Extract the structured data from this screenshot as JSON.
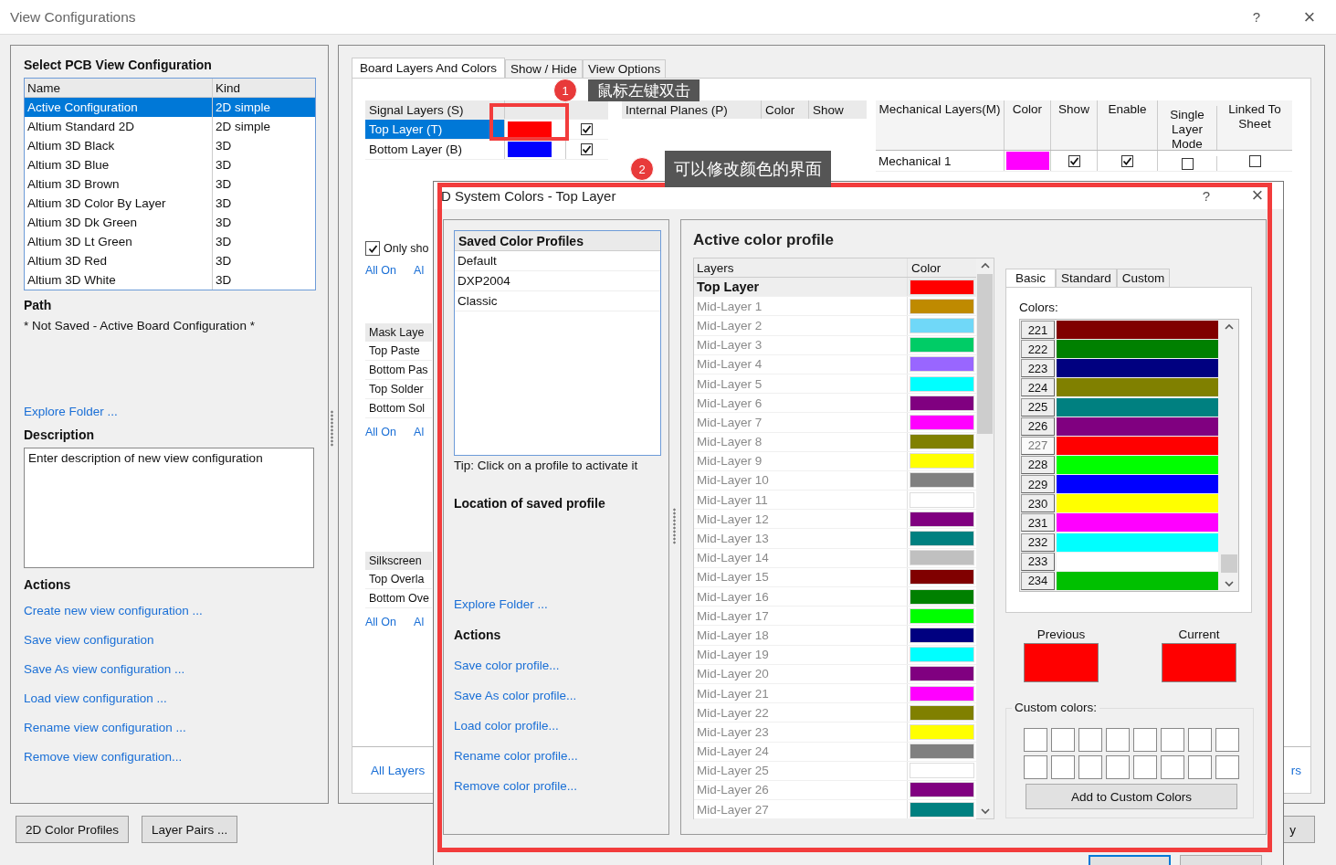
{
  "window": {
    "title": "View Configurations",
    "help": "?",
    "close": "×"
  },
  "config_panel": {
    "title": "Select PCB View Configuration",
    "columns": [
      "Name",
      "Kind"
    ],
    "rows": [
      {
        "name": "Active Configuration",
        "kind": "2D simple",
        "selected": true
      },
      {
        "name": "Altium Standard 2D",
        "kind": "2D simple",
        "selected": false
      },
      {
        "name": "Altium 3D Black",
        "kind": "3D",
        "selected": false
      },
      {
        "name": "Altium 3D Blue",
        "kind": "3D",
        "selected": false
      },
      {
        "name": "Altium 3D Brown",
        "kind": "3D",
        "selected": false
      },
      {
        "name": "Altium 3D Color By Layer",
        "kind": "3D",
        "selected": false
      },
      {
        "name": "Altium 3D Dk Green",
        "kind": "3D",
        "selected": false
      },
      {
        "name": "Altium 3D Lt Green",
        "kind": "3D",
        "selected": false
      },
      {
        "name": "Altium 3D Red",
        "kind": "3D",
        "selected": false
      },
      {
        "name": "Altium 3D White",
        "kind": "3D",
        "selected": false
      }
    ],
    "path_label": "Path",
    "path": "* Not Saved - Active Board Configuration *",
    "explore": "Explore Folder ...",
    "description_label": "Description",
    "description": "Enter description of new view configuration",
    "actions_label": "Actions",
    "actions": [
      "Create new view configuration ...",
      "Save view configuration",
      "Save As view configuration ...",
      "Load view configuration ...",
      "Rename view configuration ...",
      "Remove view configuration..."
    ]
  },
  "tabs": [
    {
      "label": "Board Layers And Colors",
      "selected": true
    },
    {
      "label": "Show / Hide",
      "selected": false
    },
    {
      "label": "View Options",
      "selected": false
    }
  ],
  "signal_layers": {
    "header": "Signal Layers (S)",
    "rows": [
      {
        "name": "Top Layer (T)",
        "selected": true,
        "color": "#ff0000",
        "show": true
      },
      {
        "name": "Bottom Layer (B)",
        "selected": false,
        "color": "#0000ff",
        "show": true
      }
    ]
  },
  "internal_planes": {
    "columns": [
      "Internal Planes (P)",
      "Color",
      "Show"
    ]
  },
  "mechanical_layers": {
    "columns": [
      "Mechanical Layers(M)",
      "Color",
      "Show",
      "Enable",
      "Single Layer Mode",
      "Linked To Sheet"
    ],
    "rows": [
      {
        "name": "Mechanical 1",
        "color": "#ff00ff",
        "show": true,
        "enable": true,
        "single_layer_mode": false,
        "linked_to_sheet": false
      }
    ]
  },
  "layer_sections": [
    {
      "kind": "checkbox",
      "label": "Only sho",
      "checked": true
    },
    {
      "kind": "links",
      "links": [
        "All On",
        "Al"
      ]
    },
    {
      "kind": "table",
      "header": "Mask Laye",
      "rows": [
        "Top Paste",
        "Bottom Pas",
        "Top Solder",
        "Bottom Sol"
      ]
    },
    {
      "kind": "links",
      "links": [
        "All On",
        "Al"
      ]
    },
    {
      "kind": "table",
      "header": "Silkscreen",
      "rows": [
        "Top Overla",
        "Bottom Ove"
      ]
    },
    {
      "kind": "links",
      "links": [
        "All On",
        "Al"
      ]
    }
  ],
  "all_layers_link": "All Layers",
  "right_link": "rs",
  "bottom_buttons": [
    "2D Color Profiles",
    "Layer Pairs ..."
  ],
  "right_button": "y",
  "annotations": [
    {
      "number": "1",
      "text": "鼠标左键双击"
    },
    {
      "number": "2",
      "text": "可以修改颜色的界面"
    }
  ],
  "dialog": {
    "title": "D System Colors - Top Layer",
    "help": "?",
    "close": "×",
    "profiles": {
      "header": "Saved Color Profiles",
      "items": [
        "Default",
        "DXP2004",
        "Classic"
      ]
    },
    "tip": "Tip: Click on a profile to activate it",
    "location_label": "Location of saved profile",
    "explore": "Explore Folder ...",
    "actions_label": "Actions",
    "actions": [
      "Save color profile...",
      "Save As color profile...",
      "Load color profile...",
      "Rename color profile...",
      "Remove color profile..."
    ],
    "active_title": "Active color profile",
    "layer_columns": [
      "Layers",
      "Color"
    ],
    "layers": [
      {
        "name": "Top Layer",
        "color": "#ff0000",
        "selected": true,
        "enabled": true
      },
      {
        "name": "Mid-Layer 1",
        "color": "#bf8a00",
        "selected": false,
        "enabled": false
      },
      {
        "name": "Mid-Layer 2",
        "color": "#70d8f8",
        "selected": false,
        "enabled": false
      },
      {
        "name": "Mid-Layer 3",
        "color": "#00cc66",
        "selected": false,
        "enabled": false
      },
      {
        "name": "Mid-Layer 4",
        "color": "#9966ff",
        "selected": false,
        "enabled": false
      },
      {
        "name": "Mid-Layer 5",
        "color": "#00ffff",
        "selected": false,
        "enabled": false
      },
      {
        "name": "Mid-Layer 6",
        "color": "#800080",
        "selected": false,
        "enabled": false
      },
      {
        "name": "Mid-Layer 7",
        "color": "#ff00ff",
        "selected": false,
        "enabled": false
      },
      {
        "name": "Mid-Layer 8",
        "color": "#808000",
        "selected": false,
        "enabled": false
      },
      {
        "name": "Mid-Layer 9",
        "color": "#ffff00",
        "selected": false,
        "enabled": false
      },
      {
        "name": "Mid-Layer 10",
        "color": "#808080",
        "selected": false,
        "enabled": false
      },
      {
        "name": "Mid-Layer 11",
        "color": "#ffffff",
        "selected": false,
        "enabled": false
      },
      {
        "name": "Mid-Layer 12",
        "color": "#800080",
        "selected": false,
        "enabled": false
      },
      {
        "name": "Mid-Layer 13",
        "color": "#008080",
        "selected": false,
        "enabled": false
      },
      {
        "name": "Mid-Layer 14",
        "color": "#c0c0c0",
        "selected": false,
        "enabled": false
      },
      {
        "name": "Mid-Layer 15",
        "color": "#800000",
        "selected": false,
        "enabled": false
      },
      {
        "name": "Mid-Layer 16",
        "color": "#008000",
        "selected": false,
        "enabled": false
      },
      {
        "name": "Mid-Layer 17",
        "color": "#00ff00",
        "selected": false,
        "enabled": false
      },
      {
        "name": "Mid-Layer 18",
        "color": "#000080",
        "selected": false,
        "enabled": false
      },
      {
        "name": "Mid-Layer 19",
        "color": "#00ffff",
        "selected": false,
        "enabled": false
      },
      {
        "name": "Mid-Layer 20",
        "color": "#800080",
        "selected": false,
        "enabled": false
      },
      {
        "name": "Mid-Layer 21",
        "color": "#ff00ff",
        "selected": false,
        "enabled": false
      },
      {
        "name": "Mid-Layer 22",
        "color": "#808000",
        "selected": false,
        "enabled": false
      },
      {
        "name": "Mid-Layer 23",
        "color": "#ffff00",
        "selected": false,
        "enabled": false
      },
      {
        "name": "Mid-Layer 24",
        "color": "#808080",
        "selected": false,
        "enabled": false
      },
      {
        "name": "Mid-Layer 25",
        "color": "#ffffff",
        "selected": false,
        "enabled": false
      },
      {
        "name": "Mid-Layer 26",
        "color": "#800080",
        "selected": false,
        "enabled": false
      },
      {
        "name": "Mid-Layer 27",
        "color": "#008080",
        "selected": false,
        "enabled": false
      }
    ],
    "color_tabs": [
      {
        "label": "Basic",
        "selected": true
      },
      {
        "label": "Standard",
        "selected": false
      },
      {
        "label": "Custom",
        "selected": false
      }
    ],
    "colors_label": "Colors:",
    "palette": [
      {
        "index": "221",
        "color": "#800000",
        "selected": false
      },
      {
        "index": "222",
        "color": "#008000",
        "selected": false
      },
      {
        "index": "223",
        "color": "#000080",
        "selected": false
      },
      {
        "index": "224",
        "color": "#808000",
        "selected": false
      },
      {
        "index": "225",
        "color": "#008080",
        "selected": false
      },
      {
        "index": "226",
        "color": "#800080",
        "selected": false
      },
      {
        "index": "227",
        "color": "#ff0000",
        "selected": true
      },
      {
        "index": "228",
        "color": "#00ff00",
        "selected": false
      },
      {
        "index": "229",
        "color": "#0000ff",
        "selected": false
      },
      {
        "index": "230",
        "color": "#ffff00",
        "selected": false
      },
      {
        "index": "231",
        "color": "#ff00ff",
        "selected": false
      },
      {
        "index": "232",
        "color": "#00ffff",
        "selected": false
      },
      {
        "index": "233",
        "color": "#ffffff",
        "selected": false
      },
      {
        "index": "234",
        "color": "#00c000",
        "selected": false
      }
    ],
    "swatches": [
      {
        "label": "Previous",
        "color": "#ff0000"
      },
      {
        "label": "Current",
        "color": "#ff0000"
      }
    ],
    "custom_label": "Custom colors:",
    "add_button": "Add to Custom Colors"
  }
}
